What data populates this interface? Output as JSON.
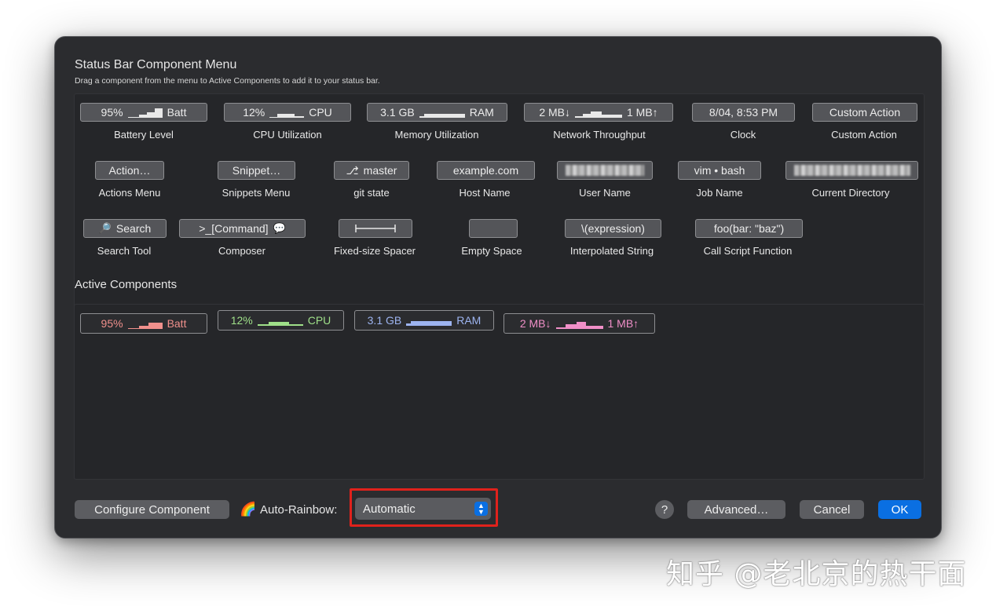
{
  "dialog": {
    "title": "Status Bar Component Menu",
    "subtitle": "Drag a component from the menu to Active Components to add it to your status bar.",
    "active_title": "Active Components"
  },
  "components": [
    {
      "id": "battery",
      "chip_left": "95%",
      "chip_right": "Batt",
      "label": "Battery Level"
    },
    {
      "id": "cpu",
      "chip_left": "12%",
      "chip_right": "CPU",
      "label": "CPU Utilization"
    },
    {
      "id": "memory",
      "chip_left": "3.1 GB",
      "chip_right": "RAM",
      "label": "Memory Utilization"
    },
    {
      "id": "network",
      "chip_left": "2 MB↓",
      "chip_right": "1 MB↑",
      "label": "Network Throughput"
    },
    {
      "id": "clock",
      "chip": "8/04, 8:53 PM",
      "label": "Clock"
    },
    {
      "id": "custom-action",
      "chip": "Custom Action",
      "label": "Custom Action"
    },
    {
      "id": "actions-menu",
      "chip": "Action…",
      "label": "Actions Menu"
    },
    {
      "id": "snippets-menu",
      "chip": "Snippet…",
      "label": "Snippets Menu"
    },
    {
      "id": "git-state",
      "chip": "master",
      "label": "git state"
    },
    {
      "id": "host-name",
      "chip": "example.com",
      "label": "Host Name"
    },
    {
      "id": "user-name",
      "label": "User Name"
    },
    {
      "id": "job-name",
      "chip": "vim • bash",
      "label": "Job Name"
    },
    {
      "id": "current-directory",
      "label": "Current Directory"
    },
    {
      "id": "search-tool",
      "chip": "Search",
      "label": "Search Tool"
    },
    {
      "id": "composer",
      "chip": ">_[Command]",
      "label": "Composer"
    },
    {
      "id": "fixed-spacer",
      "label": "Fixed-size Spacer"
    },
    {
      "id": "empty-space",
      "label": "Empty Space"
    },
    {
      "id": "interpolated-string",
      "chip": "\\(expression)",
      "label": "Interpolated String"
    },
    {
      "id": "call-script",
      "chip": "foo(bar: \"baz\")",
      "label": "Call Script Function"
    }
  ],
  "active": [
    {
      "id": "battery",
      "left": "95%",
      "right": "Batt",
      "color": "#f0908c"
    },
    {
      "id": "cpu",
      "left": "12%",
      "right": "CPU",
      "color": "#9fe089"
    },
    {
      "id": "memory",
      "left": "3.1 GB",
      "right": "RAM",
      "color": "#9db4f0"
    },
    {
      "id": "network",
      "left": "2 MB↓",
      "right": "1 MB↑",
      "color": "#f08fc8"
    }
  ],
  "footer": {
    "configure": "Configure Component",
    "rainbow_label": "Auto-Rainbow:",
    "rainbow_value": "Automatic",
    "help": "?",
    "advanced": "Advanced…",
    "cancel": "Cancel",
    "ok": "OK"
  },
  "icons": {
    "rainbow": "rainbow-icon",
    "search": "magnifier-icon",
    "composer": "speech-bubble-icon",
    "git": "branch-icon"
  },
  "watermark": "知乎 @老北京的热干面"
}
